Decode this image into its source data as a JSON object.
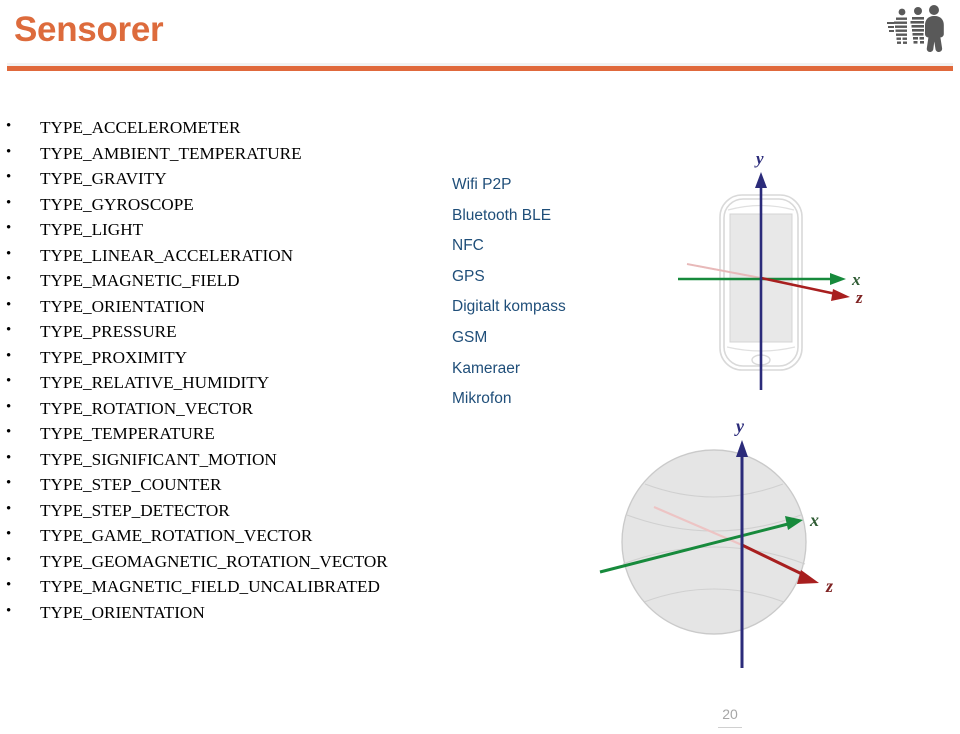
{
  "header": {
    "title": "Sensorer",
    "accent_color": "#e0693c",
    "logo_icon": "walking-people-logo"
  },
  "sensor_list": {
    "items": [
      "TYPE_ACCELEROMETER",
      "TYPE_AMBIENT_TEMPERATURE",
      "TYPE_GRAVITY",
      "TYPE_GYROSCOPE",
      "TYPE_LIGHT",
      "TYPE_LINEAR_ACCELERATION",
      "TYPE_MAGNETIC_FIELD",
      "TYPE_ORIENTATION",
      "TYPE_PRESSURE",
      "TYPE_PROXIMITY",
      "TYPE_RELATIVE_HUMIDITY",
      "TYPE_ROTATION_VECTOR",
      "TYPE_TEMPERATURE",
      "TYPE_SIGNIFICANT_MOTION",
      "TYPE_STEP_COUNTER",
      "TYPE_STEP_DETECTOR",
      "TYPE_GAME_ROTATION_VECTOR",
      "TYPE_GEOMAGNETIC_ROTATION_VECTOR",
      "TYPE_MAGNETIC_FIELD_UNCALIBRATED",
      "TYPE_ORIENTATION"
    ]
  },
  "feature_list": {
    "text_color": "#1f4e79",
    "items": [
      "Wifi P2P",
      "Bluetooth BLE",
      "NFC",
      "GPS",
      "Digitalt kompass",
      "GSM",
      "Kameraer",
      "Mikrofon"
    ]
  },
  "figures": {
    "phone": {
      "name": "phone-coordinate-axes-diagram",
      "axis_labels": {
        "y": "y",
        "x": "x",
        "z": "z"
      },
      "axis_colors": {
        "y": "#2b2b7a",
        "x": "#178a3c",
        "z": "#a81f1f"
      }
    },
    "sphere": {
      "name": "globe-coordinate-axes-diagram",
      "axis_labels": {
        "y": "y",
        "x": "x",
        "z": "z"
      },
      "axis_colors": {
        "y": "#2b2b7a",
        "x": "#178a3c",
        "z": "#a81f1f"
      }
    }
  },
  "footer": {
    "page_number": "20"
  }
}
